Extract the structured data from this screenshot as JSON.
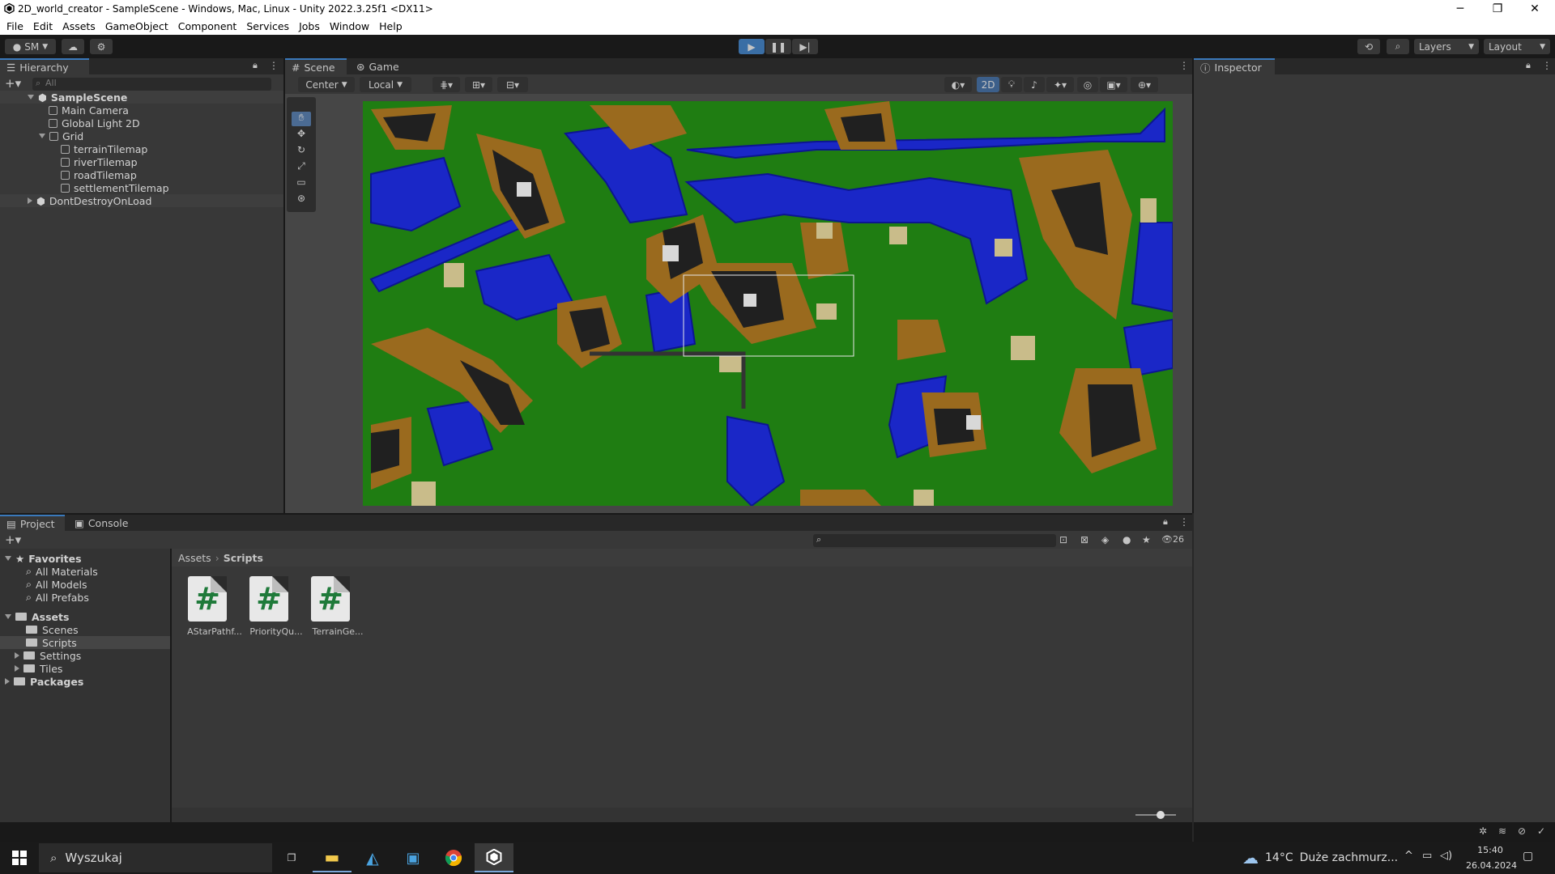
{
  "window": {
    "title": "2D_world_creator - SampleScene - Windows, Mac, Linux - Unity 2022.3.25f1 <DX11>",
    "min_icon": "minimize-icon",
    "max_icon": "restore-icon",
    "close_icon": "close-icon"
  },
  "menu": [
    "File",
    "Edit",
    "Assets",
    "GameObject",
    "Component",
    "Services",
    "Jobs",
    "Window",
    "Help"
  ],
  "toolbar": {
    "account": "SM",
    "layers": "Layers",
    "layout": "Layout"
  },
  "hierarchy": {
    "tab": "Hierarchy",
    "search_placeholder": "All",
    "items": [
      {
        "label": "SampleScene"
      },
      {
        "label": "Main Camera"
      },
      {
        "label": "Global Light 2D"
      },
      {
        "label": "Grid"
      },
      {
        "label": "terrainTilemap"
      },
      {
        "label": "riverTilemap"
      },
      {
        "label": "roadTilemap"
      },
      {
        "label": "settlementTilemap"
      },
      {
        "label": "DontDestroyOnLoad"
      }
    ]
  },
  "scene": {
    "tabs": [
      "Scene",
      "Game"
    ],
    "pivot": "Center",
    "space": "Local",
    "mode_2d": "2D"
  },
  "inspector": {
    "tab": "Inspector"
  },
  "project": {
    "tabs": [
      "Project",
      "Console"
    ],
    "hidden_count": "26",
    "favorites": {
      "label": "Favorites",
      "items": [
        "All Materials",
        "All Models",
        "All Prefabs"
      ]
    },
    "assets": {
      "label": "Assets",
      "items": [
        "Scenes",
        "Scripts",
        "Settings",
        "Tiles"
      ]
    },
    "packages": "Packages",
    "breadcrumb": [
      "Assets",
      "Scripts"
    ],
    "files": [
      {
        "name": "AStarPathf..."
      },
      {
        "name": "PriorityQu..."
      },
      {
        "name": "TerrainGe..."
      }
    ]
  },
  "taskbar": {
    "search": "Wyszukaj",
    "weather": "14°C",
    "weather_desc": "Duże zachmurz...",
    "time": "15:40",
    "date": "26.04.2024"
  }
}
